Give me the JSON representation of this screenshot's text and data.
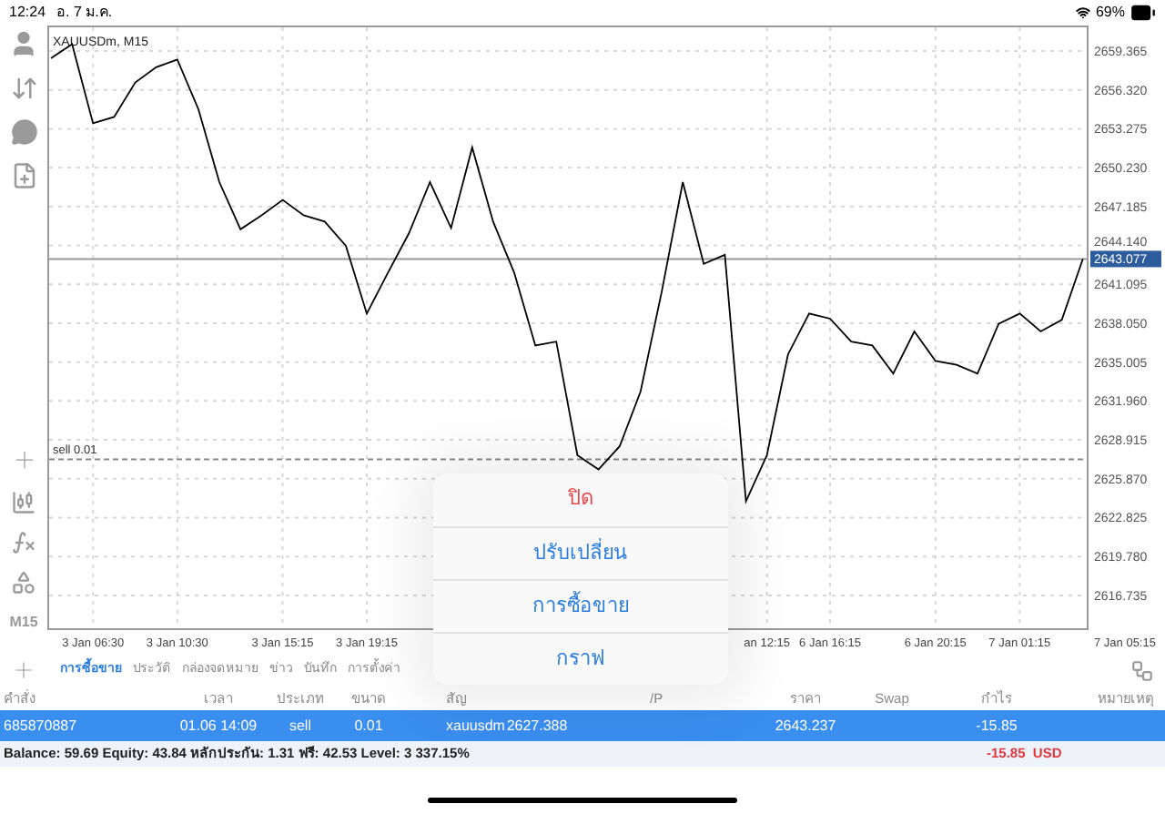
{
  "status_bar": {
    "time": "12:24",
    "date": "อ. 7 ม.ค.",
    "battery": "69%"
  },
  "toolbar": {
    "timeframe": "M15"
  },
  "chart": {
    "chart_data": {
      "type": "line",
      "title": "XAUUSDm, M15",
      "grid": true,
      "ylim": [
        2614.16,
        2661.36
      ],
      "categories": [
        null,
        null,
        "3 Jan 06:30",
        null,
        null,
        null,
        "3 Jan 10:30",
        null,
        null,
        null,
        null,
        "3 Jan 15:15",
        null,
        null,
        null,
        "3 Jan 19:15",
        null,
        null,
        null,
        null,
        null,
        null,
        null,
        null,
        null,
        null,
        null,
        null,
        null,
        null,
        null,
        null,
        null,
        null,
        "an 12:15",
        null,
        null,
        "6 Jan 16:15",
        null,
        null,
        null,
        null,
        "6 Jan 20:15",
        null,
        null,
        null,
        "7 Jan 01:15",
        null,
        null,
        null,
        null,
        "7 Jan 05:15"
      ],
      "series": [
        {
          "color": "#000000",
          "values": [
            2658.8,
            2659.9,
            2653.7,
            2654.2,
            2656.9,
            2658.1,
            2658.7,
            2654.8,
            2649.1,
            2645.4,
            2646.5,
            2647.7,
            2646.5,
            2646.0,
            2644.1,
            2638.8,
            2642.0,
            2645.1,
            2649.1,
            2645.5,
            2651.8,
            2646.0,
            2642.0,
            2636.3,
            2636.6,
            2627.7,
            2626.6,
            2628.4,
            2632.7,
            2640.5,
            2649.1,
            2642.7,
            2643.4,
            2624.1,
            2627.7,
            2635.6,
            2638.8,
            2638.4,
            2636.6,
            2636.3,
            2634.1,
            2637.4,
            2635.1,
            2634.8,
            2634.1,
            2638.0,
            2638.8,
            2637.4,
            2638.3,
            2643.1,
            null,
            null
          ]
        }
      ],
      "ref_lines": [
        {
          "axis": "y",
          "value": 2643.077,
          "label": "2643.077"
        },
        {
          "axis": "y",
          "value": 2627.388,
          "label": "sell 0.01"
        }
      ],
      "yticks": [
        {
          "value": 2659.365,
          "label": "2659.365"
        },
        {
          "value": 2656.32,
          "label": "2656.320"
        },
        {
          "value": 2653.275,
          "label": "2653.275"
        },
        {
          "value": 2650.23,
          "label": "2650.230"
        },
        {
          "value": 2647.185,
          "label": "2647.185"
        },
        {
          "value": 2644.14,
          "label": "2644.140"
        },
        {
          "value": 2641.095,
          "label": "2641.095"
        },
        {
          "value": 2638.05,
          "label": "2638.050"
        },
        {
          "value": 2635.005,
          "label": "2635.005"
        },
        {
          "value": 2631.96,
          "label": "2631.960"
        },
        {
          "value": 2628.915,
          "label": "2628.915"
        },
        {
          "value": 2625.87,
          "label": "2625.870"
        },
        {
          "value": 2622.825,
          "label": "2622.825"
        },
        {
          "value": 2619.78,
          "label": "2619.780"
        },
        {
          "value": 2616.735,
          "label": "2616.735"
        }
      ]
    }
  },
  "tabs": [
    {
      "label": "การซื้อขาย",
      "selected": true
    },
    {
      "label": "ประวัติ",
      "selected": false
    },
    {
      "label": "กล่องจดหมาย",
      "selected": false
    },
    {
      "label": "ข่าว",
      "selected": false
    },
    {
      "label": "บันทึก",
      "selected": false
    },
    {
      "label": "การตั้งค่า",
      "selected": false
    }
  ],
  "table": {
    "columns": [
      {
        "label": "คำสั่ง"
      },
      {
        "label": "เวลา"
      },
      {
        "label": "ประเภท"
      },
      {
        "label": "ขนาด"
      },
      {
        "label": "สัญ"
      },
      {},
      {},
      {
        "label": "/P"
      },
      {
        "label": "ราคา"
      },
      {
        "label": "Swap"
      },
      {
        "label": "กำไร"
      },
      {
        "label": "หมายเหตุ"
      }
    ],
    "rows": [
      {
        "selected": true,
        "cells": [
          {
            "text": "685870887"
          },
          {
            "text": "01.06 14:09"
          },
          {
            "text": "sell"
          },
          {
            "text": "0.01"
          },
          {
            "text": "xauusdm"
          },
          {
            "text": "2627.388"
          },
          {},
          {},
          {
            "text": "2643.237"
          },
          {},
          {
            "text": "-15.85"
          },
          {}
        ]
      }
    ]
  },
  "summary": {
    "text": "Balance: 59.69 Equity: 43.84 หลักประกัน: 1.31 ฟรี: 42.53 Level: 3 337.15%",
    "profit": "-15.85  USD"
  },
  "popup_menu": {
    "items": [
      {
        "label": "ปิด",
        "kind": "destructive"
      },
      {
        "label": "ปรับเปลี่ยน",
        "kind": "action"
      },
      {
        "label": "การซื้อขาย",
        "kind": "action"
      },
      {
        "label": "กราฟ",
        "kind": "action"
      }
    ]
  }
}
